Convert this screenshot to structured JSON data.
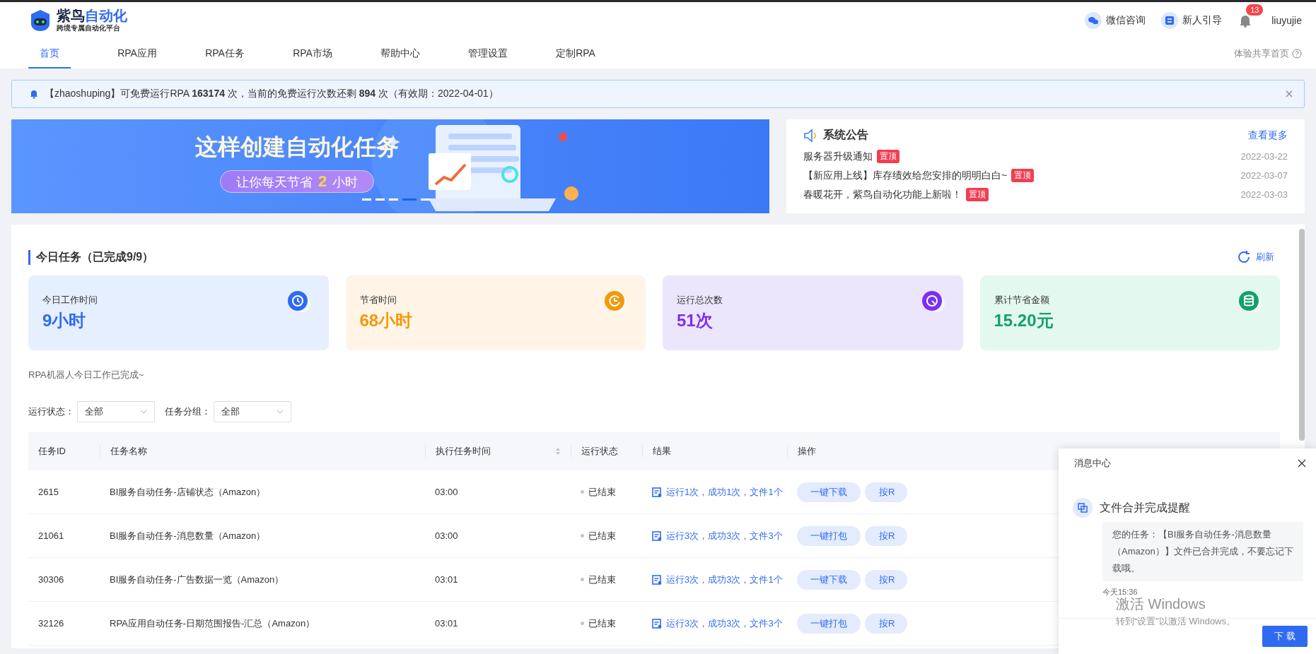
{
  "header": {
    "logo": {
      "title_a": "紫鸟",
      "title_b": "自动化",
      "subtitle": "跨境专属自动化平台"
    },
    "actions": [
      {
        "label": "微信咨询",
        "kind": "wechat"
      },
      {
        "label": "新人引导",
        "kind": "guide"
      }
    ],
    "notifications": {
      "count": "13"
    },
    "user": "liuyujie"
  },
  "nav": {
    "tabs": [
      {
        "label": "首页",
        "selected": true
      },
      {
        "label": "RPA应用",
        "selected": false
      },
      {
        "label": "RPA任务",
        "selected": false
      },
      {
        "label": "RPA市场",
        "selected": false
      },
      {
        "label": "帮助中心",
        "selected": false
      },
      {
        "label": "管理设置",
        "selected": false
      },
      {
        "label": "定制RPA",
        "selected": false
      }
    ],
    "share_link": "体验共享首页"
  },
  "notice": {
    "text": "【zhaoshuping】可免费运行RPA **163174** 次，当前的免费运行次数还剩 **894** 次（有效期：2022-04-01）"
  },
  "banner": {
    "headline": "这样创建自动化任务",
    "tagline_before": "让你每天节省",
    "tagline_highlight": "2",
    "tagline_after": "小时",
    "dots": [
      {
        "selected": false
      },
      {
        "selected": false
      },
      {
        "selected": false
      },
      {
        "selected": true
      },
      {
        "selected": false
      }
    ]
  },
  "announcements": {
    "title": "系统公告",
    "more": "查看更多",
    "items": [
      {
        "title": "服务器升级通知",
        "tag": "置顶",
        "date": "2022-03-22"
      },
      {
        "title": "【新应用上线】库存绩效给您安排的明明白白~",
        "tag": "置顶",
        "date": "2022-03-07"
      },
      {
        "title": "春暖花开，紫鸟自动化功能上新啦！",
        "tag": "置顶",
        "date": "2022-03-03"
      }
    ]
  },
  "today": {
    "title": "今日任务（已完成9/9）",
    "refresh": "刷新",
    "stats": [
      {
        "label": "今日工作时间",
        "value": "9小时",
        "kind": "timer",
        "color": "#2f6bf0"
      },
      {
        "label": "节省时间",
        "value": "68小时",
        "kind": "clock",
        "color": "#f29a0b"
      },
      {
        "label": "运行总次数",
        "value": "51次",
        "kind": "gauge",
        "color": "#7b2ff2"
      },
      {
        "label": "累计节省金额",
        "value": "15.20元",
        "kind": "coins",
        "color": "#14a06a"
      }
    ],
    "message": "RPA机器人今日工作已完成~",
    "filters": [
      {
        "label": "运行状态：",
        "value": "全部"
      },
      {
        "label": "任务分组：",
        "value": "全部"
      }
    ]
  },
  "table": {
    "columns": [
      {
        "label": "任务ID",
        "sortable": false
      },
      {
        "label": "任务名称",
        "sortable": false
      },
      {
        "label": "执行任务时间",
        "sortable": true
      },
      {
        "label": "运行状态",
        "sortable": false
      },
      {
        "label": "结果",
        "sortable": false
      },
      {
        "label": "操作",
        "sortable": false
      }
    ],
    "rows": [
      {
        "id": "2615",
        "name": "BI服务自动任务-店铺状态（Amazon）",
        "time": "03:00",
        "status": "已结束",
        "result": "运行1次，成功1次，文件1个",
        "actions": [
          "一键下载",
          "按R"
        ]
      },
      {
        "id": "21061",
        "name": "BI服务自动任务-消息数量（Amazon）",
        "time": "03:00",
        "status": "已结束",
        "result": "运行3次，成功3次，文件3个",
        "actions": [
          "一键打包",
          "按R"
        ]
      },
      {
        "id": "30306",
        "name": "BI服务自动任务-广告数据一览（Amazon）",
        "time": "03:01",
        "status": "已结束",
        "result": "运行3次，成功3次，文件1个",
        "actions": [
          "一键下载",
          "按R"
        ]
      },
      {
        "id": "32126",
        "name": "RPA应用自动任务-日期范围报告-汇总（Amazon）",
        "time": "03:01",
        "status": "已结束",
        "result": "运行3次，成功3次，文件3个",
        "actions": [
          "一键打包",
          "按R"
        ]
      }
    ]
  },
  "message_center": {
    "title": "消息中心",
    "items": [
      {
        "title": "文件合并完成提醒",
        "body": "您的任务：【BI服务自动任务-消息数量（Amazon）】文件已合并完成，不要忘记下载哦。",
        "time": "今天15:36"
      }
    ],
    "button": "下 载"
  },
  "os_watermark": {
    "title": "激活 Windows",
    "subtitle": "转到“设置”以激活 Windows。"
  }
}
